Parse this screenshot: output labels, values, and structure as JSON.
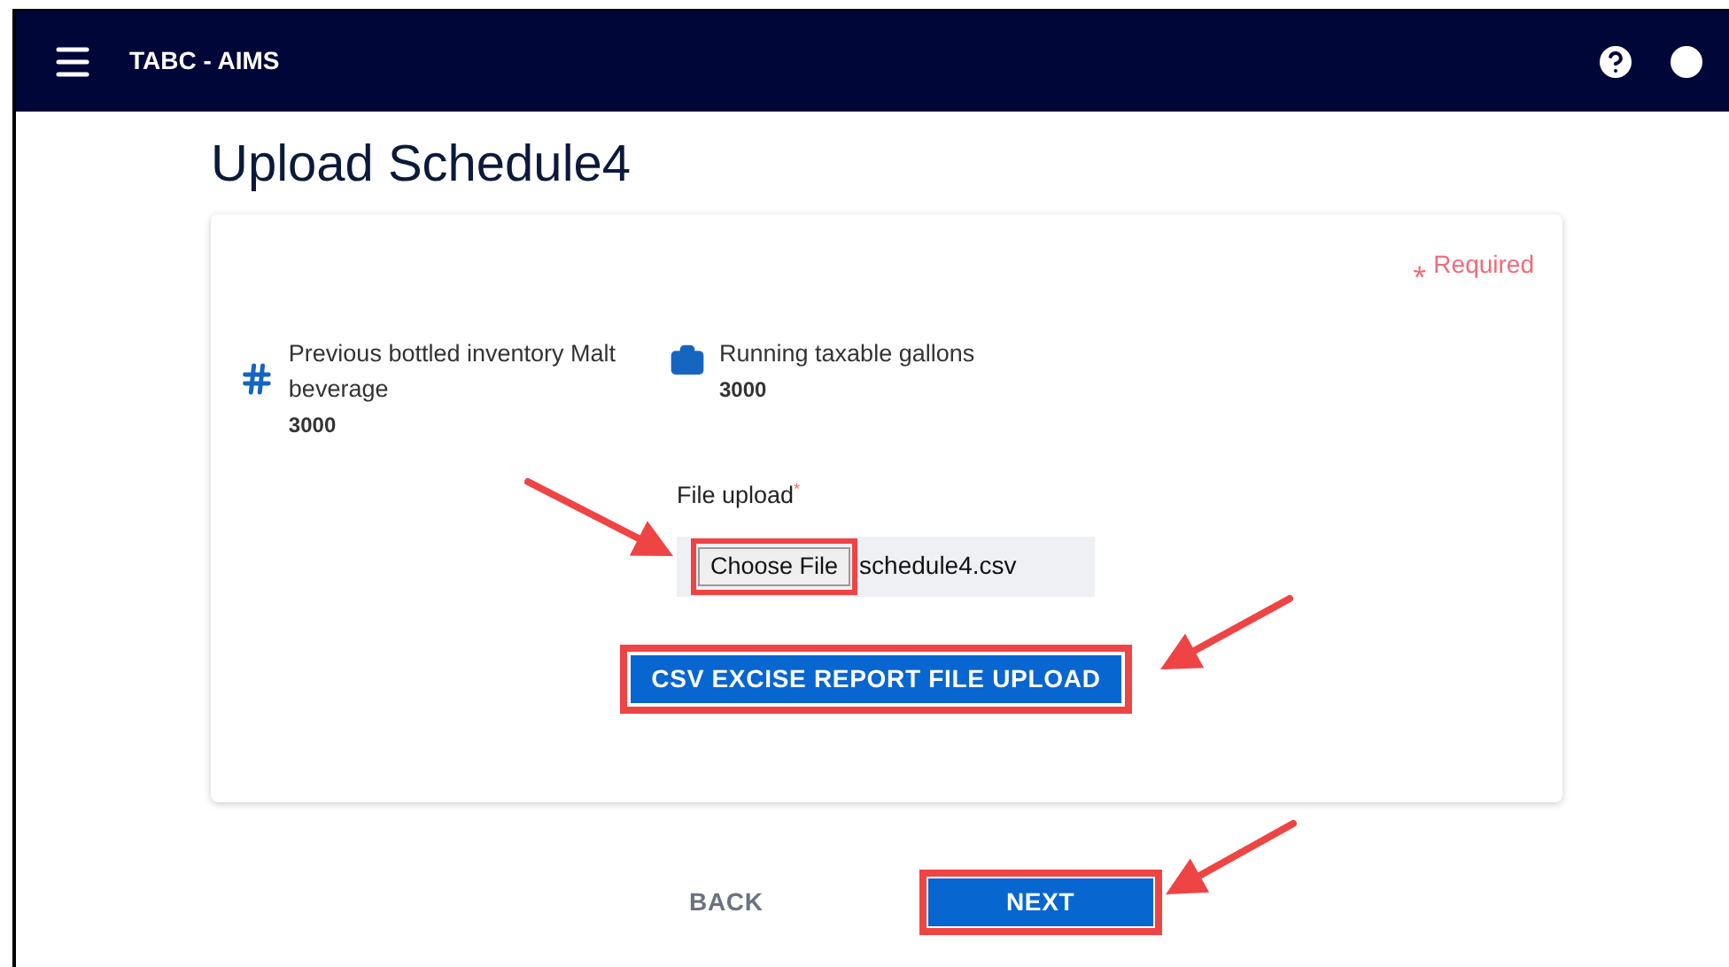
{
  "app_bar": {
    "title": "TABC - AIMS"
  },
  "page_title": "Upload Schedule4",
  "required_note": "⁎ Required",
  "stats": [
    {
      "kind": "count",
      "label": "Previous bottled inventory Malt beverage",
      "value": "3000"
    },
    {
      "kind": "case",
      "label": "Running taxable gallons",
      "value": "3000"
    }
  ],
  "file_upload": {
    "label": "File upload",
    "required_mark": "*",
    "button": "Choose File",
    "file_name": "schedule4.csv"
  },
  "upload_button": "CSV EXCISE REPORT FILE UPLOAD",
  "footer": {
    "back": "BACK",
    "next": "NEXT"
  }
}
